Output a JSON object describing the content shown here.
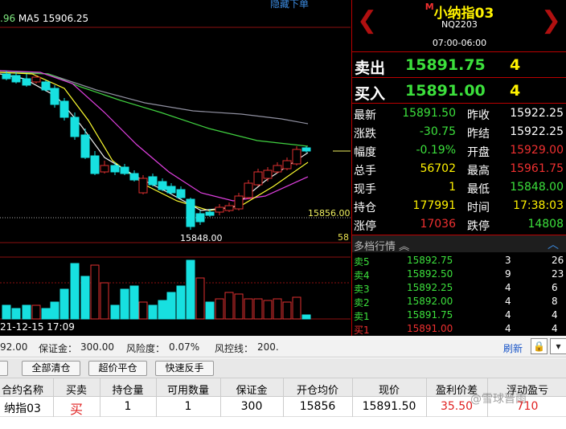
{
  "chart": {
    "ma_prefix": ".96",
    "ma5_label": "MA5 15906.25",
    "hide_order": "隐藏下单",
    "low_label": "15848.00",
    "last_price_tag": "15856.00",
    "scale_label": "58",
    "date_label": "21-12-15 17:09"
  },
  "quote": {
    "title_marker": "M",
    "title": "小纳指03",
    "code": "NQ2203",
    "session": "07:00-06:00",
    "ask": {
      "label": "卖出",
      "price": "15891.75",
      "volume": "4"
    },
    "bid": {
      "label": "买入",
      "price": "15891.00",
      "volume": "4"
    },
    "rows": [
      {
        "l1": "最新",
        "v1": "15891.50",
        "c1": "green",
        "l2": "昨收",
        "v2": "15922.25",
        "c2": "white"
      },
      {
        "l1": "涨跌",
        "v1": "-30.75",
        "c1": "green",
        "l2": "昨结",
        "v2": "15922.25",
        "c2": "white"
      },
      {
        "l1": "幅度",
        "v1": "-0.19%",
        "c1": "green",
        "l2": "开盘",
        "v2": "15929.00",
        "c2": "red"
      },
      {
        "l1": "总手",
        "v1": "56702",
        "c1": "yellow",
        "l2": "最高",
        "v2": "15961.75",
        "c2": "red"
      },
      {
        "l1": "现手",
        "v1": "1",
        "c1": "yellow",
        "l2": "最低",
        "v2": "15848.00",
        "c2": "green"
      },
      {
        "l1": "持仓",
        "v1": "177991",
        "c1": "yellow",
        "l2": "时间",
        "v2": "17:38:03",
        "c2": "yellow"
      },
      {
        "l1": "涨停",
        "v1": "17036",
        "c1": "red",
        "l2": "跌停",
        "v2": "14808",
        "c2": "green"
      }
    ],
    "depth_title": "多档行情",
    "depth_toggle": "︽",
    "collapse_icon": "︿",
    "depth": [
      {
        "label": "卖5",
        "price": "15892.75",
        "num": "3",
        "tail": "26"
      },
      {
        "label": "卖4",
        "price": "15892.50",
        "num": "9",
        "tail": "23"
      },
      {
        "label": "卖3",
        "price": "15892.25",
        "num": "4",
        "tail": "6"
      },
      {
        "label": "卖2",
        "price": "15892.00",
        "num": "4",
        "tail": "8"
      },
      {
        "label": "卖1",
        "price": "15891.75",
        "num": "4",
        "tail": "4"
      },
      {
        "label": "买1",
        "price": "15891.00",
        "num": "4",
        "tail": "4"
      }
    ]
  },
  "account": {
    "balance_tail": "92.00",
    "margin_label": "保证金：",
    "margin_value": "300.00",
    "risk_label": "风险度：",
    "risk_value": "0.07%",
    "control_label": "风控线：",
    "control_value": "200.",
    "refresh": "刷新"
  },
  "buttons": {
    "first": "",
    "close_all": "全部清仓",
    "market_close": "超价平仓",
    "quick_reverse": "快速反手"
  },
  "positions": {
    "headers": [
      "合约名称",
      "买卖",
      "持仓量",
      "可用数量",
      "保证金",
      "开仓均价",
      "现价",
      "盈利价差",
      "浮动盈亏"
    ],
    "rows": [
      [
        "纳指03",
        "买",
        "1",
        "1",
        "300",
        "15856",
        "15891.50",
        "35.50",
        "710"
      ]
    ]
  },
  "watermark": "@雪球晋雨",
  "colors": {
    "up": "#f03030",
    "down": "#3ce03c",
    "candle_up": "#e03030",
    "candle_down": "#17e0e0",
    "ma_white": "#f0f0f0",
    "ma_yellow": "#ffff30",
    "ma_magenta": "#e040e0",
    "ma_green": "#40d040",
    "ma_grey": "#9090a0"
  }
}
